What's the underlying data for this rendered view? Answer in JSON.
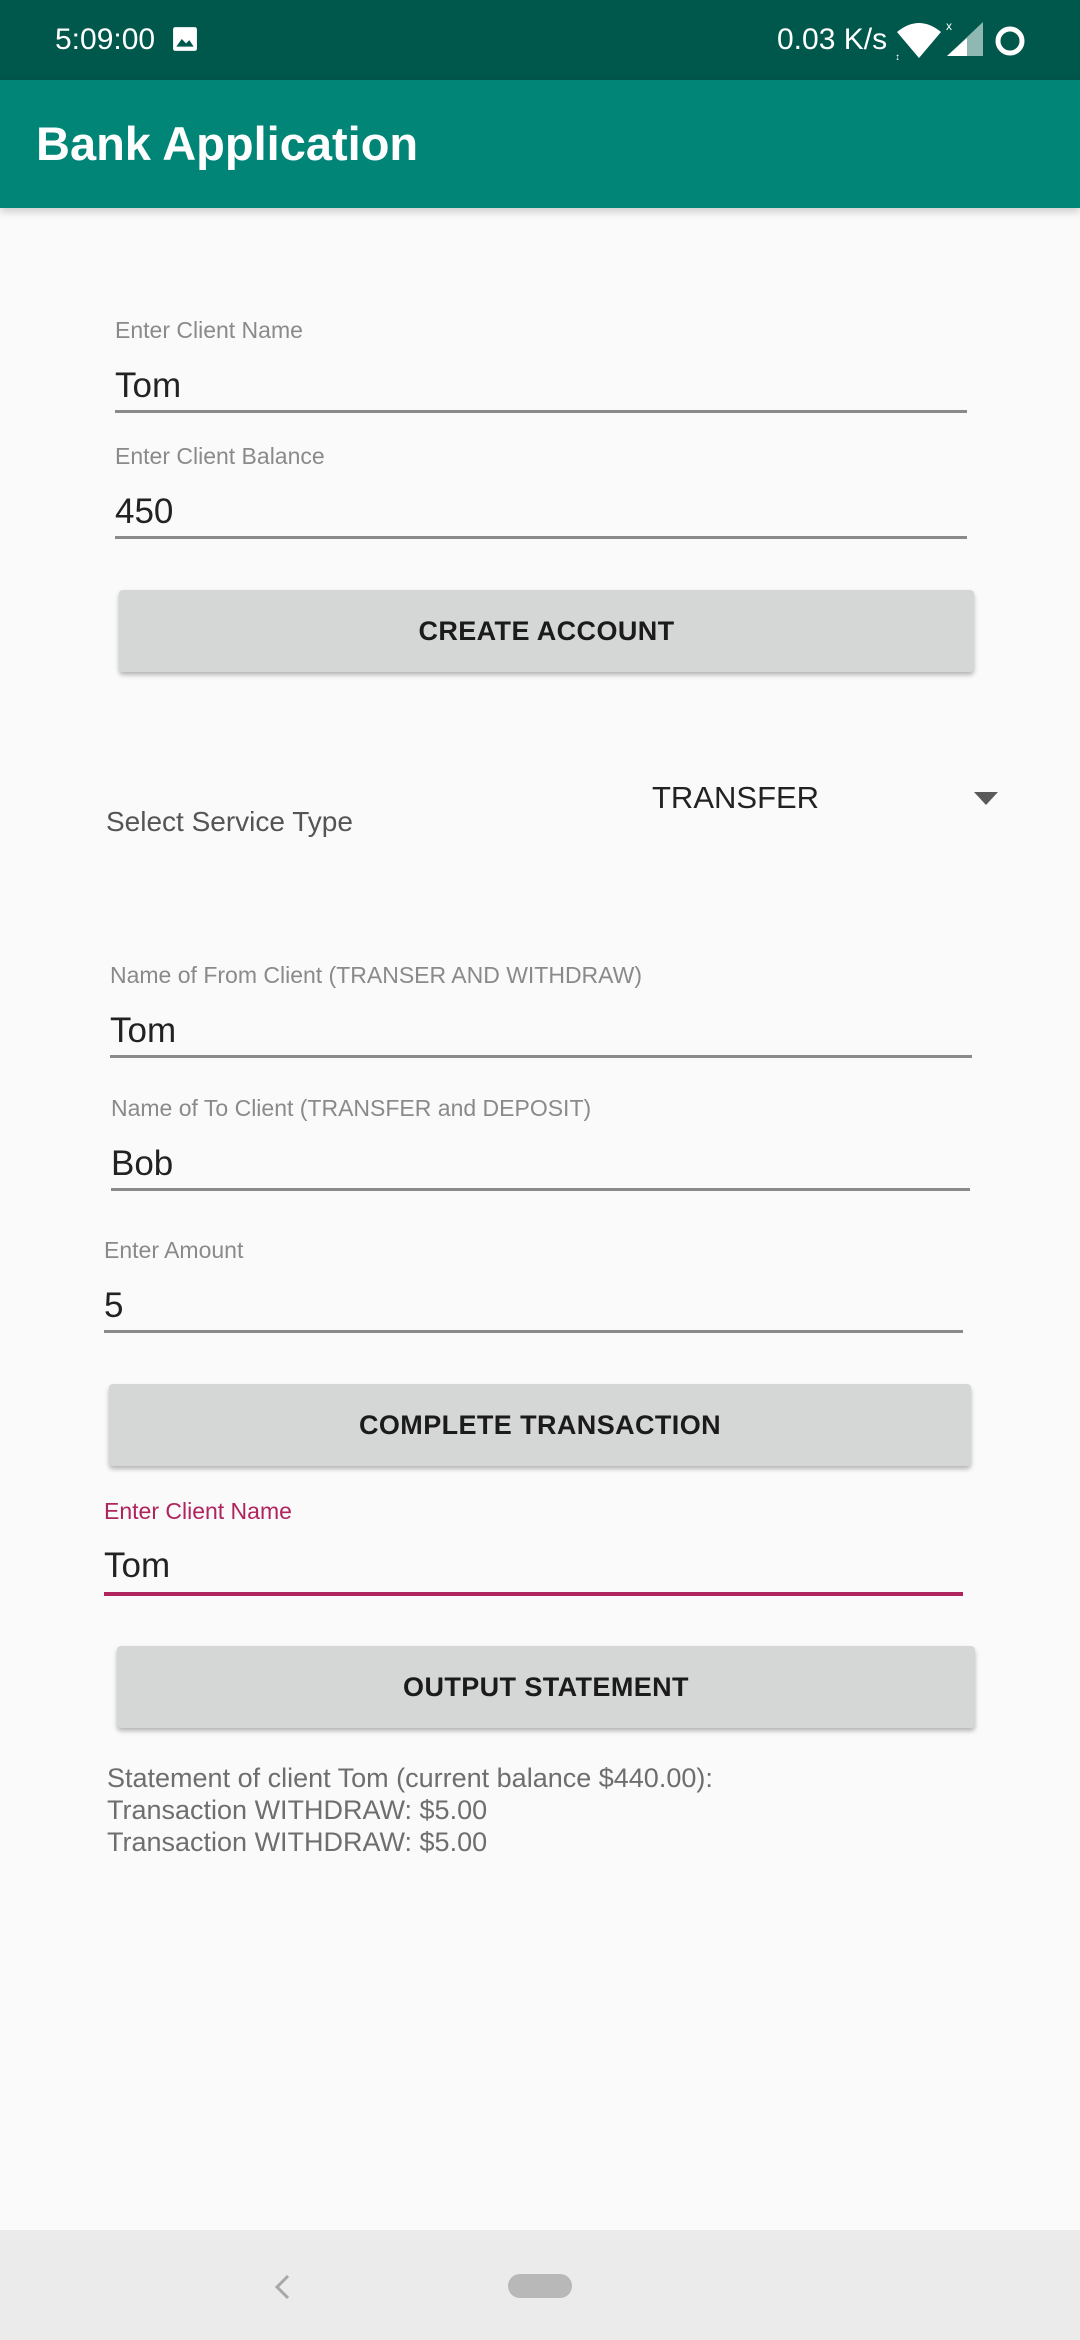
{
  "status_bar": {
    "time": "5:09:00",
    "network_speed": "0.03 K/s",
    "icons": [
      "image-icon",
      "wifi-icon",
      "signal-icon",
      "loading-ring-icon"
    ]
  },
  "app_bar": {
    "title": "Bank Application"
  },
  "create_account": {
    "client_name_label": "Enter Client Name",
    "client_name_value": "Tom",
    "client_balance_label": "Enter Client Balance",
    "client_balance_value": "450",
    "button_label": "CREATE ACCOUNT"
  },
  "service": {
    "label": "Select Service Type",
    "selected": "TRANSFER"
  },
  "transaction": {
    "from_label": "Name of From Client (TRANSER AND WITHDRAW)",
    "from_value": "Tom",
    "to_label": "Name of To Client (TRANSFER and DEPOSIT)",
    "to_value": "Bob",
    "amount_label": "Enter Amount",
    "amount_value": "5",
    "button_label": "COMPLETE TRANSACTION"
  },
  "statement_section": {
    "client_name_label": "Enter Client Name",
    "client_name_value": "Tom",
    "button_label": "OUTPUT STATEMENT",
    "output_lines": [
      "Statement of client Tom (current balance $440.00):",
      "Transaction WITHDRAW: $5.00",
      "Transaction WITHDRAW: $5.00"
    ]
  },
  "colors": {
    "status_bar": "#00574b",
    "app_bar": "#008577",
    "accent": "#b0245e",
    "button": "#d5d6d6"
  }
}
